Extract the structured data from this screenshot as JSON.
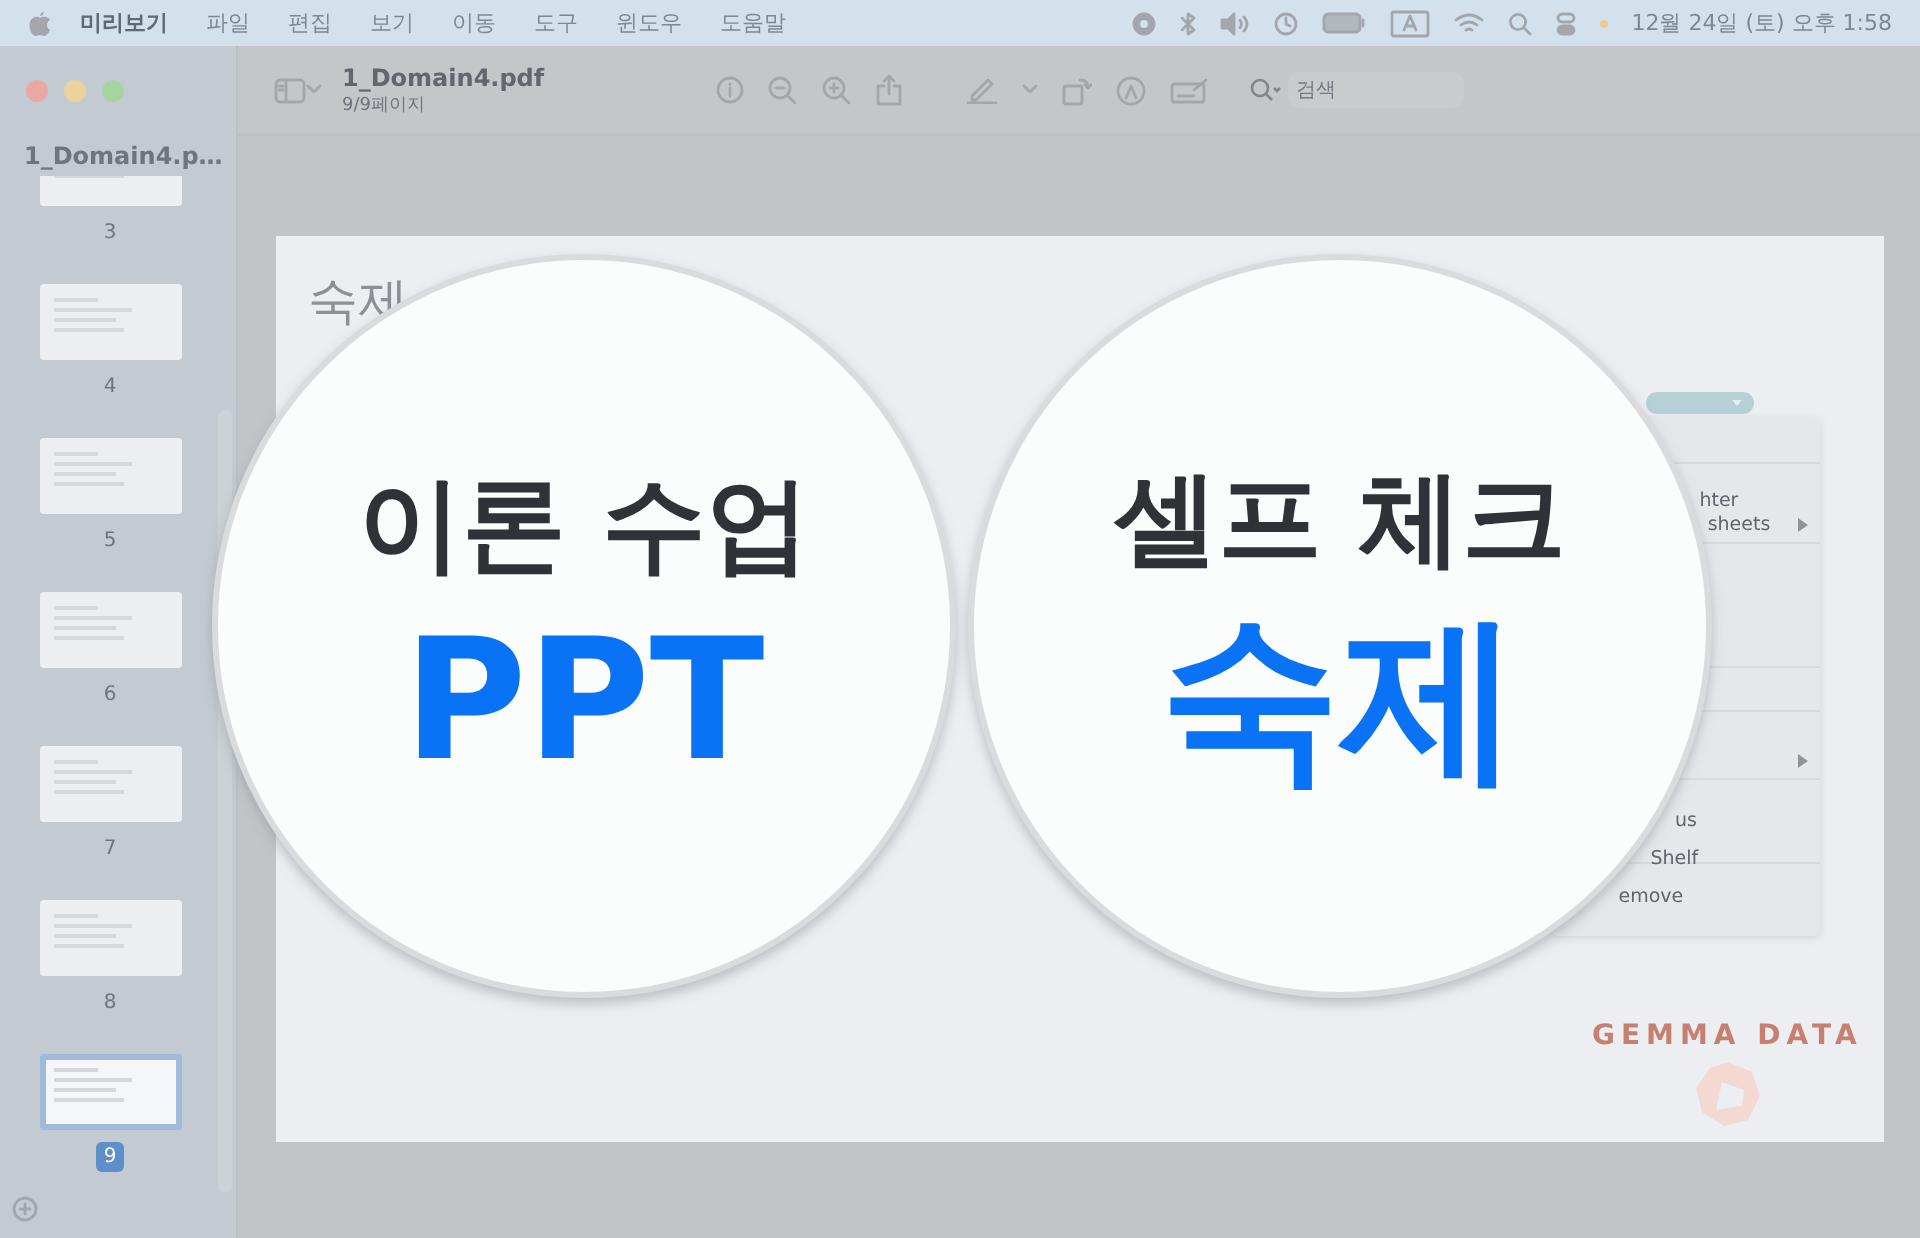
{
  "menu_bar": {
    "app_menu": "미리보기",
    "menus": [
      "파일",
      "편집",
      "보기",
      "이동",
      "도구",
      "윈도우",
      "도움말"
    ],
    "clock": "12월 24일 (토) 오후 1:58"
  },
  "window": {
    "title": "1_Domain4.pdf",
    "subtitle": "9/9페이지",
    "search": {
      "placeholder": "검색"
    }
  },
  "sidebar": {
    "title": "1_Domain4.p…",
    "pages": [
      {
        "label": "3",
        "selected": false
      },
      {
        "label": "4",
        "selected": false
      },
      {
        "label": "5",
        "selected": false
      },
      {
        "label": "6",
        "selected": false
      },
      {
        "label": "7",
        "selected": false
      },
      {
        "label": "8",
        "selected": false
      },
      {
        "label": "9",
        "selected": true
      }
    ]
  },
  "slide": {
    "title": "숙제",
    "context_menu": {
      "items": [
        {
          "label": "hter",
          "submenu": false
        },
        {
          "label": "sheets",
          "submenu": true
        },
        {
          "submenu": true
        },
        {
          "label": "us",
          "submenu": false
        },
        {
          "label": "Shelf",
          "submenu": false
        },
        {
          "label": "emove",
          "submenu": false
        }
      ]
    },
    "logo_text": "GEMMA DATA"
  },
  "overlays": [
    {
      "heading": "이론 수업",
      "highlight": "PPT"
    },
    {
      "heading": "셀프 체크",
      "highlight": "숙제"
    }
  ]
}
